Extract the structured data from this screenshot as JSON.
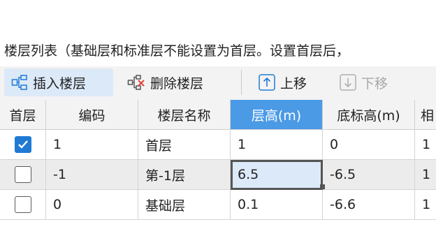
{
  "caption": "楼层列表（基础层和标准层不能设置为首层。设置首层后，",
  "toolbar": {
    "insert_label": "插入楼层",
    "delete_label": "删除楼层",
    "up_label": "上移",
    "down_label": "下移"
  },
  "table": {
    "headers": [
      "首层",
      "编码",
      "楼层名称",
      "层高(m)",
      "底标高(m)",
      "相"
    ],
    "rows": [
      {
        "is_first": true,
        "code": "1",
        "name": "首层",
        "height": "1",
        "bottom": "0",
        "count": "1"
      },
      {
        "is_first": false,
        "code": "-1",
        "name": "第-1层",
        "height": "6.5",
        "bottom": "-6.5",
        "count": "1"
      },
      {
        "is_first": false,
        "code": "0",
        "name": "基础层",
        "height": "0.1",
        "bottom": "-6.6",
        "count": "1"
      }
    ]
  },
  "colors": {
    "accent": "#1f7ad4",
    "header_selected": "#4b9ae6",
    "selection_fill": "#dce9f8",
    "delete_x": "#e0443a"
  }
}
